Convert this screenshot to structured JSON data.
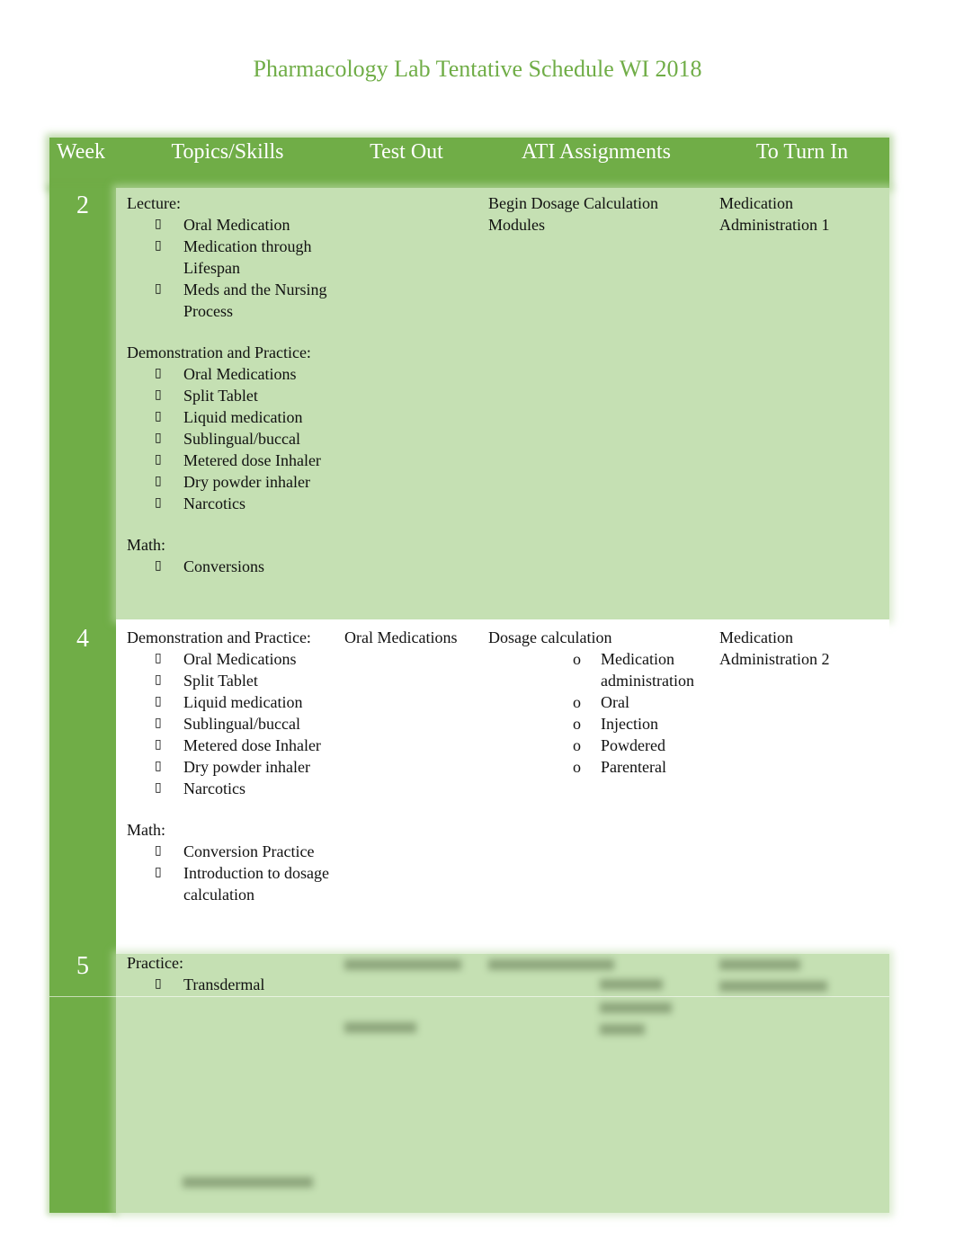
{
  "title": "Pharmacology Lab Tentative Schedule WI 2018",
  "colors": {
    "accent": "#70ad47",
    "light_green": "#c5e0b3",
    "white": "#ffffff"
  },
  "bullet_glyph": "▯",
  "sub_bullet_glyph": "o",
  "headers": [
    "Week",
    "Topics/Skills",
    "Test Out",
    "ATI Assignments",
    "To Turn In"
  ],
  "rows": [
    {
      "week": "2",
      "topics": {
        "sections": [
          {
            "label": "Lecture:",
            "items": [
              "Oral Medication",
              "Medication through Lifespan",
              "Meds and the Nursing Process"
            ]
          },
          {
            "label": "Demonstration and Practice:",
            "items": [
              "Oral Medications",
              "Split Tablet",
              "Liquid medication",
              "Sublingual/buccal",
              "Metered dose Inhaler",
              "Dry powder inhaler",
              "Narcotics"
            ]
          },
          {
            "label": "Math:",
            "items": [
              "Conversions"
            ]
          }
        ]
      },
      "test_out": "",
      "ati": {
        "text": "Begin Dosage Calculation Modules",
        "items": []
      },
      "turn_in": "Medication Administration 1"
    },
    {
      "week": "4",
      "topics": {
        "sections": [
          {
            "label": "Demonstration and Practice:",
            "items": [
              "Oral Medications",
              "Split Tablet",
              "Liquid medication",
              "Sublingual/buccal",
              "Metered dose Inhaler",
              "Dry powder inhaler",
              "Narcotics"
            ]
          },
          {
            "label": "Math:",
            "items": [
              "Conversion Practice",
              "Introduction to dosage calculation"
            ]
          }
        ]
      },
      "test_out": "Oral Medications",
      "ati": {
        "text": "Dosage calculation",
        "items": [
          "Medication administration",
          "Oral",
          "Injection",
          "Powdered",
          "Parenteral"
        ]
      },
      "turn_in": "Medication Administration 2"
    },
    {
      "week": "5",
      "topics": {
        "sections": [
          {
            "label": "Practice:",
            "items": [
              "Transdermal"
            ]
          }
        ]
      },
      "test_out": "",
      "ati": {
        "text": "",
        "items": []
      },
      "turn_in": ""
    }
  ]
}
